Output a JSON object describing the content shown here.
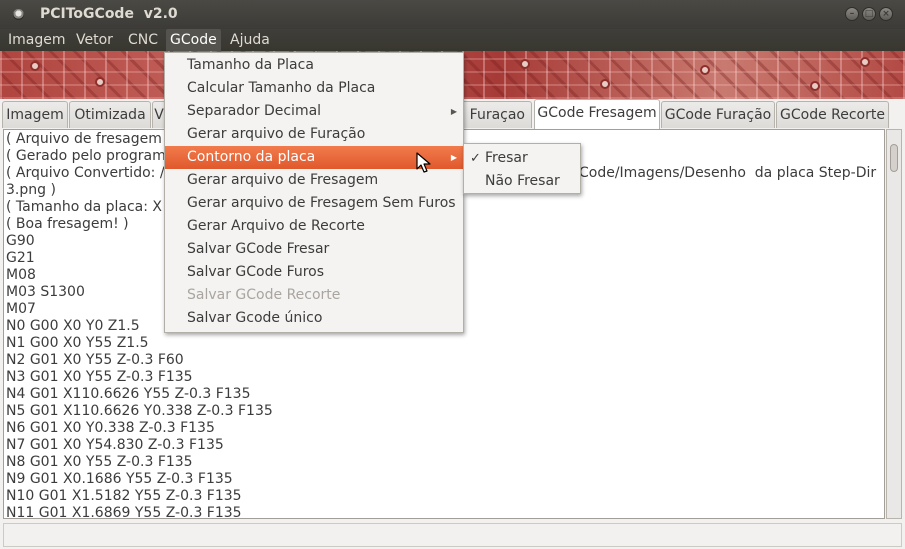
{
  "window": {
    "title": "PCIToGCode  v2.0",
    "controls": {
      "minimize": "–",
      "maximize": "□",
      "close": "×"
    }
  },
  "menubar": {
    "items": [
      {
        "label": "Imagem"
      },
      {
        "label": "Vetor"
      },
      {
        "label": "CNC"
      },
      {
        "label": "GCode",
        "active": true
      },
      {
        "label": "Ajuda"
      }
    ]
  },
  "tabs": [
    {
      "label": "Imagem"
    },
    {
      "label": "Otimizada"
    },
    {
      "label": "V"
    },
    {
      "label": "a Furaçao"
    },
    {
      "label": "GCode Fresagem",
      "selected": true
    },
    {
      "label": "GCode Furação"
    },
    {
      "label": "GCode Recorte"
    }
  ],
  "editor": {
    "lines": [
      "( Arquivo de fresagem d",
      "( Gerado pelo programa",
      "( Arquivo Convertido: /h",
      "3.png )",
      "( Tamanho da placa: X =",
      "( Boa fresagem! )",
      "G90",
      "G21",
      "M08",
      "M03 S1300",
      "M07",
      "N0 G00 X0 Y0 Z1.5",
      "N1 G00 X0 Y55 Z1.5",
      "N2 G01 X0 Y55 Z-0.3 F60",
      "N3 G01 X0 Y55 Z-0.3 F135",
      "N4 G01 X110.6626 Y55 Z-0.3 F135",
      "N5 G01 X110.6626 Y0.338 Z-0.3 F135",
      "N6 G01 X0 Y0.338 Z-0.3 F135",
      "N7 G01 X0 Y54.830 Z-0.3 F135",
      "N8 G01 X0 Y55 Z-0.3 F135",
      "N9 G01 X0.1686 Y55 Z-0.3 F135",
      "N10 G01 X1.5182 Y55 Z-0.3 F135",
      "N11 G01 X1.6869 Y55 Z-0.3 F135"
    ],
    "partial_right_text": "Code/Imagens/Desenho  da placa Step-Dir"
  },
  "gcode_menu": {
    "items": [
      {
        "label": "Tamanho da Placa"
      },
      {
        "label": "Calcular Tamanho da Placa"
      },
      {
        "label": "Separador Decimal",
        "submenu": true
      },
      {
        "label": "Gerar arquivo de Furação"
      },
      {
        "label": "Contorno da placa",
        "submenu": true,
        "highlighted": true
      },
      {
        "label": "Gerar arquivo de Fresagem"
      },
      {
        "label": "Gerar arquivo de Fresagem Sem Furos"
      },
      {
        "label": "Gerar Arquivo de Recorte"
      },
      {
        "label": "Salvar GCode Fresar"
      },
      {
        "label": "Salvar GCode Furos"
      },
      {
        "label": "Salvar GCode Recorte",
        "disabled": true
      },
      {
        "label": "Salvar Gcode único"
      }
    ]
  },
  "contorno_submenu": {
    "items": [
      {
        "label": "Fresar",
        "checked": true
      },
      {
        "label": "Não Fresar"
      }
    ]
  },
  "colors": {
    "highlight": "#e76a3a",
    "titlebar": "#3c3b37",
    "menu_background": "#f4f3f1"
  }
}
